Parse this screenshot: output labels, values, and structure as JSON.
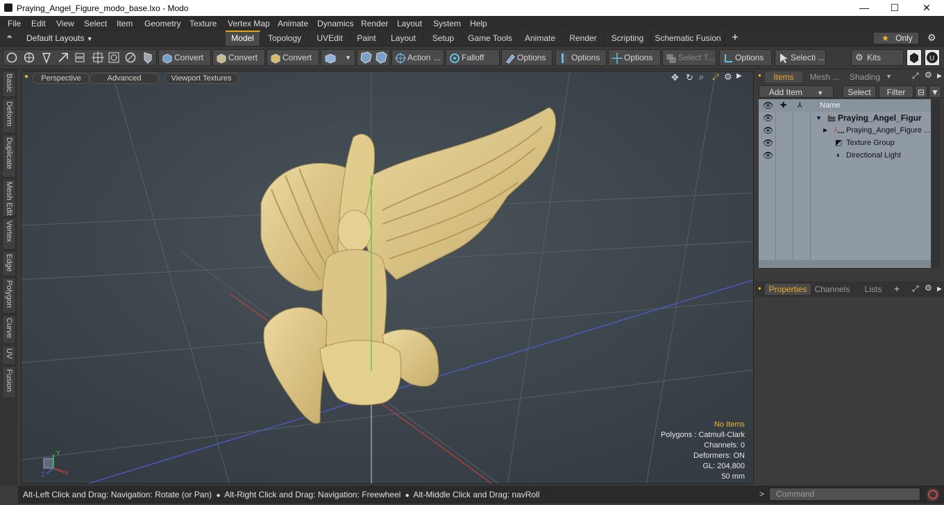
{
  "window": {
    "title": "Praying_Angel_Figure_modo_base.lxo - Modo",
    "minimize": "—",
    "maximize": "☐",
    "close": "✕"
  },
  "menu": [
    "File",
    "Edit",
    "View",
    "Select",
    "Item",
    "Geometry",
    "Texture",
    "Vertex Map",
    "Animate",
    "Dynamics",
    "Render",
    "Layout",
    "System",
    "Help"
  ],
  "layout_bar": {
    "layouts_label": "Default Layouts",
    "tabs": [
      "Model",
      "Topology",
      "UVEdit",
      "Paint",
      "Layout",
      "Setup",
      "Game Tools",
      "Animate",
      "Render",
      "Scripting",
      "Schematic Fusion"
    ],
    "active_tab": "Model",
    "add": "+",
    "only_label": "Only",
    "only_star": "★"
  },
  "toolbar": {
    "convert1": "Convert",
    "convert2": "Convert",
    "convert3": "Convert",
    "action": "Action",
    "action_more": "...",
    "falloff": "Falloff",
    "options1": "Options",
    "options2": "Options",
    "options3": "Options",
    "select_t": "Select T...",
    "options4": "Options",
    "selecti": "Selecti ...",
    "kits": "Kits"
  },
  "left_tabs": [
    "Basic",
    "Deform",
    "Duplicate",
    "Mesh Edit",
    "Vertex",
    "Edge",
    "Polygon",
    "Curve",
    "UV",
    "Fusion"
  ],
  "viewport": {
    "perspective": "Perspective",
    "advanced": "Advanced",
    "textures": "Viewport Textures",
    "axis_x": "X",
    "axis_y": "Y",
    "axis_z": "Z",
    "stats": {
      "no_items": "No Items",
      "polygons": "Polygons : Catmull-Clark",
      "channels": "Channels: 0",
      "deformers": "Deformers: ON",
      "gl": "GL: 204,800",
      "size": "50 mm"
    },
    "colors": {
      "figure": "#e3cf8e",
      "figure_shade": "#b8a062",
      "background": "#3e464d"
    }
  },
  "status": {
    "hint1": "Alt-Left Click and Drag: Navigation: Rotate (or Pan)",
    "hint2": "Alt-Right Click and Drag: Navigation: Freewheel",
    "hint3": "Alt-Middle Click and Drag: navRoll"
  },
  "items_panel": {
    "tabs": [
      "Items",
      "Mesh ...",
      "Shading"
    ],
    "active_tab": "Items",
    "add_item": "Add Item",
    "select": "Select",
    "filter": "Filter",
    "col_name": "Name",
    "rows": [
      {
        "label": "Praying_Angel_Figur ...",
        "bold": true,
        "indent": 0
      },
      {
        "label": "Praying_Angel_Figure ...",
        "bold": false,
        "indent": 1
      },
      {
        "label": "Texture Group",
        "bold": false,
        "indent": 1
      },
      {
        "label": "Directional Light",
        "bold": false,
        "indent": 1
      }
    ]
  },
  "properties_panel": {
    "tabs": [
      "Properties",
      "Channels",
      "Lists"
    ],
    "active_tab": "Properties",
    "add": "+"
  },
  "command": {
    "placeholder": "Command",
    "prompt": ">"
  }
}
